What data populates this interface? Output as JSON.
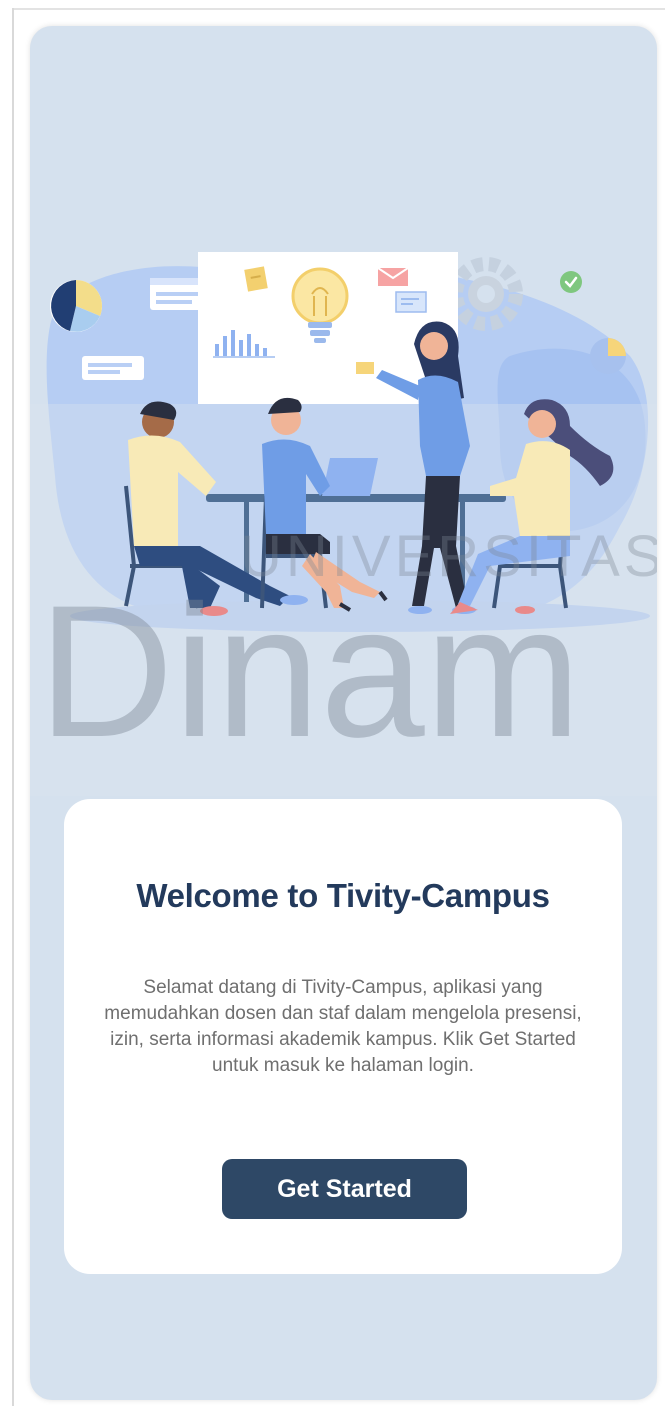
{
  "watermark": {
    "line1": "UNIVERSITAS",
    "line2": "Dinam"
  },
  "welcome": {
    "title": "Welcome to Tivity-Campus",
    "description": "Selamat datang di Tivity-Campus, aplikasi yang memudahkan dosen dan staf dalam mengelola presensi, izin, serta informasi akademik kampus. Klik Get Started untuk masuk ke halaman login.",
    "button_label": "Get Started"
  },
  "colors": {
    "screen_background": "#d5e1ee",
    "title": "#233a5c",
    "button": "#2e4866",
    "body_text": "#6f6f6f"
  },
  "icons": [
    "pie-chart-icon",
    "lightbulb-icon",
    "bar-chart-icon",
    "gear-icon",
    "check-badge-icon",
    "sticky-note-icon",
    "mail-icon"
  ]
}
